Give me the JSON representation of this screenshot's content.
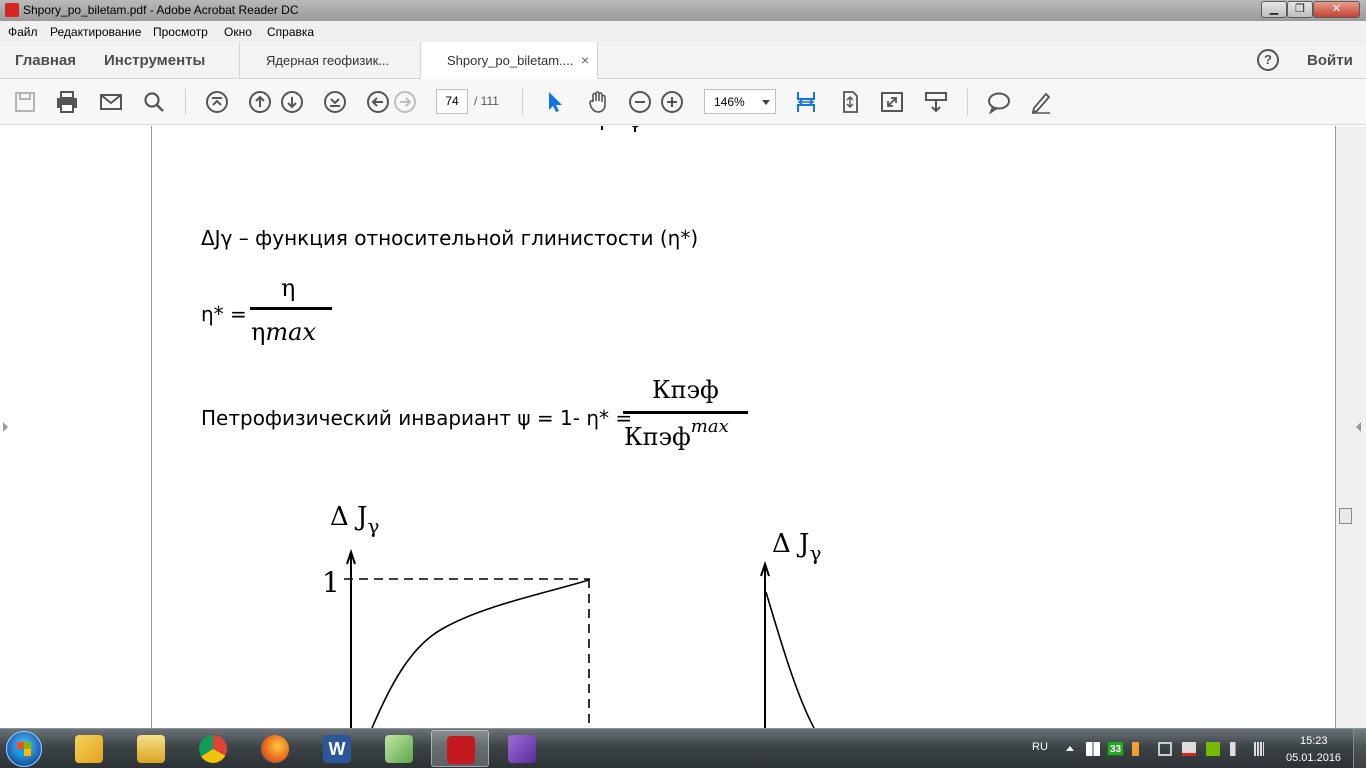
{
  "window": {
    "title": "Shpory_po_biletam.pdf - Adobe Acrobat Reader DC",
    "minimize_glyph": "▁",
    "maximize_glyph": "❐",
    "close_glyph": "✕"
  },
  "menu": [
    "Файл",
    "Редактирование",
    "Просмотр",
    "Окно",
    "Справка"
  ],
  "tabs": {
    "home": "Главная",
    "tools": "Инструменты",
    "documents": [
      {
        "label": "Ядерная геофизик..."
      },
      {
        "label": "Shpory_po_biletam...."
      }
    ],
    "close_glyph": "×",
    "help_glyph": "?",
    "sign_in": "Войти"
  },
  "toolbar": {
    "icons": [
      "save-icon",
      "print-icon",
      "email-icon",
      "search-icon",
      "first-page-icon",
      "previous-page-icon",
      "next-page-icon",
      "last-page-icon",
      "back-icon",
      "forward-icon",
      "select-cursor-icon",
      "hand-tool-icon",
      "zoom-out-icon",
      "zoom-in-icon",
      "fit-width-icon",
      "fit-page-icon",
      "full-screen-icon",
      "read-mode-icon",
      "comment-icon",
      "sign-icon"
    ],
    "page_current": "74",
    "page_total": "/ 111",
    "zoom": "146%"
  },
  "document": {
    "line1": "ΔJγ – функция относительной глинистости (η*)",
    "eq1": {
      "lhs": "η* =",
      "numerator": "η",
      "denominator_base": "η",
      "denominator_italic": "max"
    },
    "eq2": {
      "lhs": "Петрофизический инвариант ψ = 1- η* =",
      "numerator": "Кпэф",
      "denominator_base": "Кпэф",
      "denominator_sup": "max"
    },
    "graph1": {
      "y_label": "Δ J",
      "y_sub": "γ",
      "tick": "1"
    },
    "graph2": {
      "y_label": "Δ J",
      "y_sub": "γ"
    }
  },
  "taskbar": {
    "apps": [
      "explorer-icon",
      "file-manager-icon",
      "chrome-icon",
      "firefox-icon",
      "word-icon",
      "notepad-icon",
      "acrobat-icon",
      "visual-studio-icon"
    ],
    "active_app": "acrobat-icon",
    "language": "RU",
    "badge": "33",
    "time": "15:23",
    "date": "05.01.2016"
  }
}
